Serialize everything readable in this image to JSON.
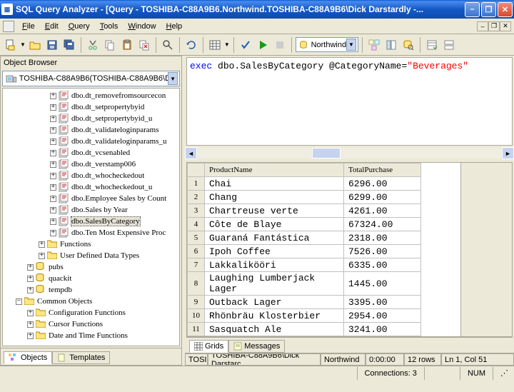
{
  "window": {
    "title": "SQL Query Analyzer - [Query - TOSHIBA-C88A9B6.Northwind.TOSHIBA-C88A9B6\\Dick Darstardly -..."
  },
  "menu": {
    "file": "File",
    "edit": "Edit",
    "query": "Query",
    "tools": "Tools",
    "window": "Window",
    "help": "Help"
  },
  "toolbar": {
    "db_selected": "Northwind"
  },
  "object_browser": {
    "title": "Object Browser",
    "server": "TOSHIBA-C88A9B6(TOSHIBA-C88A9B6\\D",
    "tree": {
      "sp": [
        "dbo.dt_removefromsourcecon",
        "dbo.dt_setpropertybyid",
        "dbo.dt_setpropertybyid_u",
        "dbo.dt_validateloginparams",
        "dbo.dt_validateloginparams_u",
        "dbo.dt_vcsenabled",
        "dbo.dt_verstamp006",
        "dbo.dt_whocheckedout",
        "dbo.dt_whocheckedout_u",
        "dbo.Employee Sales by Count",
        "dbo.Sales by Year",
        "dbo.SalesByCategory",
        "dbo.Ten Most Expensive Proc"
      ],
      "folders1": [
        "Functions",
        "User Defined Data Types"
      ],
      "dbs": [
        "pubs",
        "quackit",
        "tempdb"
      ],
      "common": "Common Objects",
      "folders2": [
        "Configuration Functions",
        "Cursor Functions",
        "Date and Time Functions"
      ]
    },
    "tabs": {
      "objects": "Objects",
      "templates": "Templates"
    }
  },
  "query": {
    "text_parts": {
      "exec": "exec",
      "body": " dbo.SalesByCategory @CategoryName=",
      "str": "\"Beverages\""
    }
  },
  "results": {
    "columns": [
      "ProductName",
      "TotalPurchase"
    ],
    "rows": [
      [
        "Chai",
        "6296.00"
      ],
      [
        "Chang",
        "6299.00"
      ],
      [
        "Chartreuse verte",
        "4261.00"
      ],
      [
        "Côte de Blaye",
        "67324.00"
      ],
      [
        "Guaraná Fantástica",
        "2318.00"
      ],
      [
        "Ipoh Coffee",
        "7526.00"
      ],
      [
        "Lakkalikööri",
        "6335.00"
      ],
      [
        "Laughing Lumberjack Lager",
        "1445.00"
      ],
      [
        "Outback Lager",
        "3395.00"
      ],
      [
        "Rhönbräu Klosterbier",
        "2954.00"
      ],
      [
        "Sasquatch Ale",
        "3241.00"
      ]
    ],
    "tabs": {
      "grids": "Grids",
      "messages": "Messages"
    }
  },
  "status": {
    "s1": "TOSI",
    "s2": "TOSHIBA-C88A9B6\\Dick Darstarc",
    "db": "Northwind",
    "time": "0:00:00",
    "rows": "12 rows",
    "pos": "Ln 1, Col 51"
  },
  "global_status": {
    "conn": "Connections: 3",
    "num": "NUM"
  }
}
